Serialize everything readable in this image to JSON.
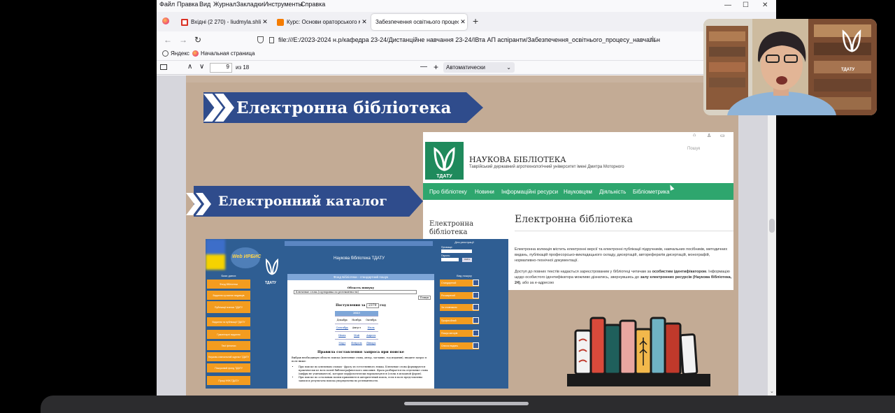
{
  "menubar": {
    "items": [
      {
        "label": "Файл"
      },
      {
        "label": "Правка"
      },
      {
        "label": "Вид"
      },
      {
        "label": "Журнал"
      },
      {
        "label": "Закладки"
      },
      {
        "label": "Инструменты"
      },
      {
        "label": "Справка"
      }
    ],
    "controls": {
      "minimize": "—",
      "maximize": "☐",
      "close": "✕"
    }
  },
  "tabs": [
    {
      "title": "Вхідні (2 270) - liudmyla.shlicina",
      "favicon_color": "#d93025",
      "active": false
    },
    {
      "title": "Курс: Основи ораторського ма",
      "favicon_color": "#f57c00",
      "active": false
    },
    {
      "title": "Забезпечення освітнього процесу",
      "favicon_color": "#e0e0e0",
      "active": true
    }
  ],
  "tab_close": "✕",
  "new_tab": "+",
  "nav": {
    "back": "←",
    "forward": "→",
    "reload": "↻",
    "url": "file:///E:/2023-2024 н.р/кафедра 23-24/Дистанційне навчання 23-24/ІВта АП аспіранти/Забезпечення_освітнього_процесу_навчальн",
    "star": "☆"
  },
  "bookmarks": [
    {
      "label": "Яндекс",
      "icon": "globe-icon"
    },
    {
      "label": "Начальная страница",
      "icon": "firefox-icon"
    }
  ],
  "pdf": {
    "sidebar_toggle": "▯",
    "prev": "∧",
    "next": "∨",
    "page": "9",
    "of_total": "из 18",
    "zoom_out": "—",
    "zoom_in": "+",
    "zoom": "Автоматически"
  },
  "slide": {
    "banner1": "Електронна бібліотека",
    "banner2": "Електронний каталог",
    "library_site": {
      "icons": [
        "⌂",
        "♙",
        "▭"
      ],
      "search_placeholder": "Пошук",
      "logo_caption": "ТДАТУ",
      "title": "НАУКОВА БІБЛІОТЕКА",
      "subtitle": "Таврійський державний агротехнологічний університет імені Дмитра Моторного",
      "menu": [
        "Про бібліотеку",
        "Новини",
        "Інформаційні ресурси",
        "Науковцям",
        "Діяльність",
        "Бібліометрика"
      ],
      "sidebar_heading": "Електронна бібліотека",
      "page_heading": "Електронна бібліотека",
      "paragraph1": "Електронна колекція містить електронні версії та електронні публікації підручників, навчальних посібників, методичних видань, публікацій професорсько-викладацького складу, дисертацій, авторефератів дисертацій, монографій, нормативно-технічної документації.",
      "paragraph2_a": "Доступ до повних текстів надається зареєстрованим у бібліотеці читачам за ",
      "paragraph2_b": "особистим ідентифікатором",
      "paragraph2_c": ". Інформацію щодо особистого ідентифікатора можливо дізнатись, звернувшись до ",
      "paragraph2_d": "залу електронних ресурсів (Наукова бібліотека, 24)",
      "paragraph2_e": ", або за е-адресою"
    },
    "catalog": {
      "logo": "Web ИРБИС",
      "logo_caption": "ТДАТУ",
      "title": "Наукова бібліотека ТДАТУ",
      "form_title": "Фонд Бібліотеки - стандартний пошук",
      "search_area_label": "Область пошуку",
      "search_area_value": "Ключевые слова (сортировка по релевантности)",
      "search_button": "Пошук",
      "period_label_a": "Поступления за",
      "period_year": "2370",
      "period_label_b": "год",
      "calendar_year": "2023",
      "calendar": [
        [
          "Декабрь",
          "Ноябрь",
          "Октябрь"
        ],
        [
          "Сентябрь",
          "Август",
          "Июль"
        ],
        [
          "Июнь",
          "Май",
          "Апрель"
        ],
        [
          "Март",
          "Февраль",
          "Январь"
        ]
      ],
      "rules_heading": "Правила составления запроса при поиске",
      "rules_intro": "Выбрав необходимую область поиска (ключевые слова, автор, заглавие, год издания), вводите запрос в поле ниже:",
      "rules_items": [
        "При поиске по ключевым словам - фразу из естественного языка. Ключевые слова формируются практически из всех полей библиографического описания. Фраза разбирается на отдельные слова (цифры не учитываются), которые морфологически нормализуются (слова в исходной форме).",
        "При поиске по остальным полям применяется авторитетный поиск, если в поле представлены записи и результаты поиска упорядочены по релевантности."
      ],
      "left_menu_header": "Бази даних",
      "left_menu": [
        "Фонд бібліотеки",
        "Видання сучасних видавців",
        "Публікації вчених ТДАТУ",
        "Видання та публікації ТДАТУ",
        "Гуманітарні видання",
        "Твої фінанси",
        "Науково-навчальний журнал ТДАТУ",
        "Пошуковий фонд ТДАТУ",
        "Праці НФК ТДАТУ"
      ],
      "right_header": "Для реєстрації",
      "right_fields": [
        "Прізвище:",
        "Пароль:"
      ],
      "right_button": "Увійти",
      "right_header2": "Вид пошуку",
      "right_menu": [
        "Стандартний",
        "Розширений",
        "За словником",
        "Професійний",
        "Пошук авторів",
        "Список видань"
      ]
    }
  },
  "webcam": {
    "logo_caption": "ТДАТУ"
  }
}
